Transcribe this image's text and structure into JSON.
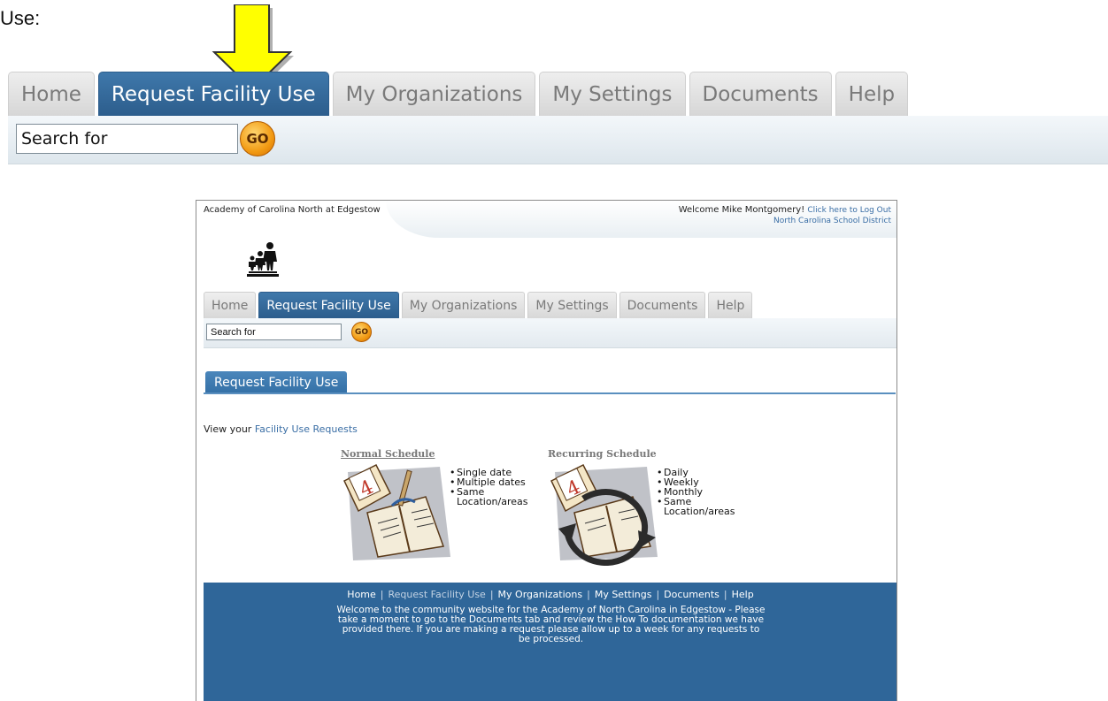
{
  "caption": {
    "use_label": "Use:"
  },
  "big_tabs": [
    {
      "label": "Home",
      "active": false
    },
    {
      "label": "Request Facility Use",
      "active": true
    },
    {
      "label": "My Organizations",
      "active": false
    },
    {
      "label": "My Settings",
      "active": false
    },
    {
      "label": "Documents",
      "active": false
    },
    {
      "label": "Help",
      "active": false
    }
  ],
  "big_search": {
    "value": "Search for",
    "go_label": "GO"
  },
  "colors": {
    "accent": "#2c5d8c",
    "go": "#f29a13",
    "arrow": "#ffff00",
    "footer": "#2f6699",
    "link": "#3a6ea5"
  },
  "site": {
    "org_name": "Academy of Carolina North at Edgestow",
    "welcome": "Welcome Mike Montgomery!",
    "logout": "Click here to Log Out",
    "district": "North Carolina School District",
    "tabs": [
      {
        "label": "Home",
        "active": false
      },
      {
        "label": "Request Facility Use",
        "active": true
      },
      {
        "label": "My Organizations",
        "active": false
      },
      {
        "label": "My Settings",
        "active": false
      },
      {
        "label": "Documents",
        "active": false
      },
      {
        "label": "Help",
        "active": false
      }
    ],
    "search": {
      "value": "Search for",
      "go_label": "GO"
    },
    "section_title": "Request Facility Use",
    "view_prefix": "View your",
    "view_link": "Facility Use Requests",
    "normal": {
      "title": "Normal Schedule",
      "items": [
        "Single date",
        "Multiple dates",
        "Same Location/areas"
      ]
    },
    "recurring": {
      "title": "Recurring Schedule",
      "items": [
        "Daily",
        "Weekly",
        "Monthly",
        "Same Location/areas"
      ]
    },
    "footer": {
      "nav": [
        "Home",
        "Request Facility Use",
        "My Organizations",
        "My Settings",
        "Documents",
        "Help"
      ],
      "text": "Welcome to the community website for the Academy of North Carolina in Edgestow - Please take a moment to go to the Documents tab and review the How To documentation we have provided there. If you are making a request please allow up to a week for any requests to be processed."
    }
  }
}
